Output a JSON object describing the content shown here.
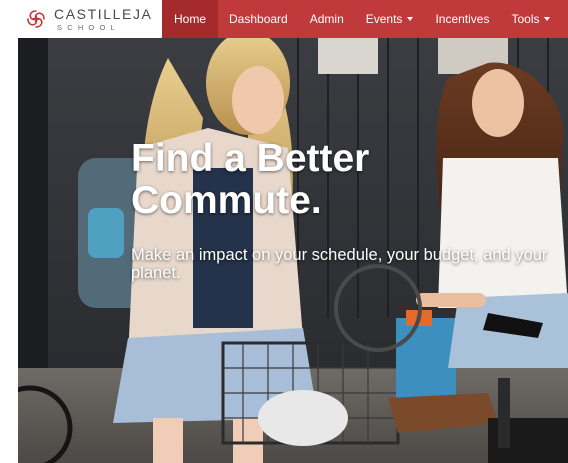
{
  "brand": {
    "name": "CASTILLEJA",
    "sub": "SCHOOL",
    "color": "#c0393b"
  },
  "nav": {
    "items": [
      {
        "label": "Home",
        "active": true
      },
      {
        "label": "Dashboard"
      },
      {
        "label": "Admin"
      },
      {
        "label": "Events",
        "dropdown": true
      },
      {
        "label": "Incentives"
      },
      {
        "label": "Tools",
        "dropdown": true
      }
    ]
  },
  "hero": {
    "title": "Find a Better Commute.",
    "subtitle": "Make an impact on your schedule, your budget, and your planet."
  },
  "colors": {
    "navbar": "#c0393b",
    "nav_active": "#a52a2c",
    "text_light": "#ffffff"
  }
}
